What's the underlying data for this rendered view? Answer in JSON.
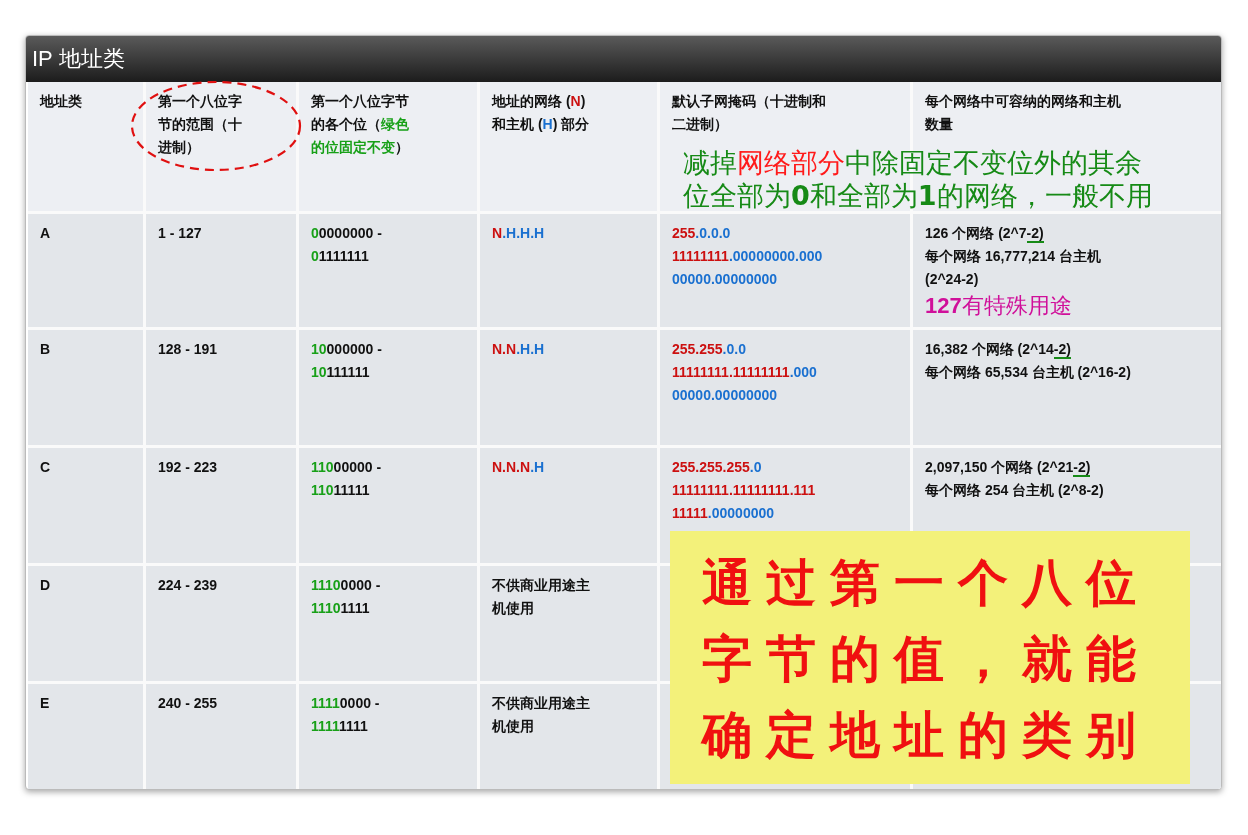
{
  "panel": {
    "title": "IP 地址类"
  },
  "table": {
    "columns": [
      {
        "lines": [
          [
            {
              "text": "地址类"
            }
          ]
        ]
      },
      {
        "lines": [
          [
            {
              "text": "第一个八位字"
            }
          ],
          [
            {
              "text": "节的范围（十"
            }
          ],
          [
            {
              "text": "进制）"
            }
          ]
        ]
      },
      {
        "lines": [
          [
            {
              "text": "第一个八位字节"
            }
          ],
          [
            {
              "text": "的各个位（"
            },
            {
              "text": "绿色",
              "color": "#18a018"
            }
          ],
          [
            {
              "text": "的位固定不变",
              "color": "#18a018"
            },
            {
              "text": "）"
            }
          ]
        ]
      },
      {
        "lines": [
          [
            {
              "text": "地址的网络 ("
            },
            {
              "text": "N",
              "color": "#cc1010"
            },
            {
              "text": ")"
            }
          ],
          [
            {
              "text": "和主机 ("
            },
            {
              "text": "H",
              "color": "#1a70d0"
            },
            {
              "text": ") 部分"
            }
          ]
        ]
      },
      {
        "lines": [
          [
            {
              "text": "默认子网掩码（十进制和"
            }
          ],
          [
            {
              "text": "二进制）"
            }
          ]
        ]
      },
      {
        "lines": [
          [
            {
              "text": "每个网络中可容纳的网络和主机"
            }
          ],
          [
            {
              "text": "数量"
            }
          ]
        ]
      }
    ],
    "rows": [
      {
        "cells": [
          {
            "lines": [
              [
                {
                  "text": "A"
                }
              ]
            ]
          },
          {
            "lines": [
              [
                {
                  "text": "1 - 127"
                }
              ]
            ]
          },
          {
            "lines": [
              [
                {
                  "text": "0",
                  "color": "#18a018"
                },
                {
                  "text": "0000000 -"
                }
              ],
              [
                {
                  "text": "0",
                  "color": "#18a018"
                },
                {
                  "text": "1111111"
                }
              ]
            ]
          },
          {
            "lines": [
              [
                {
                  "text": "N",
                  "color": "#cc1010"
                },
                {
                  "text": ".H.H.H",
                  "color": "#1a70d0"
                }
              ]
            ]
          },
          {
            "lines": [
              [
                {
                  "text": "255",
                  "color": "#cc1010"
                },
                {
                  "text": ".0.0.0",
                  "color": "#1a70d0"
                }
              ],
              [
                {
                  "text": "11111111",
                  "color": "#cc1010"
                },
                {
                  "text": ".00000000.000",
                  "color": "#1a70d0"
                }
              ],
              [
                {
                  "text": "00000.00000000",
                  "color": "#1a70d0"
                }
              ]
            ]
          },
          {
            "lines": [
              [
                {
                  "text": "126 个网络 (2^7"
                },
                {
                  "text": "-2)",
                  "underline": true
                }
              ],
              [
                {
                  "text": "每个网络 16,777,214 台主机"
                }
              ],
              [
                {
                  "text": "(2^24-2)"
                }
              ]
            ],
            "note": [
              {
                "text": "127",
                "bold": true
              },
              {
                "text": "有特殊用途"
              }
            ]
          }
        ]
      },
      {
        "cells": [
          {
            "lines": [
              [
                {
                  "text": "B"
                }
              ]
            ]
          },
          {
            "lines": [
              [
                {
                  "text": "128 - 191"
                }
              ]
            ]
          },
          {
            "lines": [
              [
                {
                  "text": "10",
                  "color": "#18a018"
                },
                {
                  "text": "000000 -"
                }
              ],
              [
                {
                  "text": "10",
                  "color": "#18a018"
                },
                {
                  "text": "111111"
                }
              ]
            ]
          },
          {
            "lines": [
              [
                {
                  "text": "N.N",
                  "color": "#cc1010"
                },
                {
                  "text": ".H.H",
                  "color": "#1a70d0"
                }
              ]
            ]
          },
          {
            "lines": [
              [
                {
                  "text": "255.255",
                  "color": "#cc1010"
                },
                {
                  "text": ".0.0",
                  "color": "#1a70d0"
                }
              ],
              [
                {
                  "text": "11111111.11111111",
                  "color": "#cc1010"
                },
                {
                  "text": ".000",
                  "color": "#1a70d0"
                }
              ],
              [
                {
                  "text": "00000.00000000",
                  "color": "#1a70d0"
                }
              ]
            ]
          },
          {
            "lines": [
              [
                {
                  "text": "16,382 个网络 (2^14"
                },
                {
                  "text": "-2)",
                  "underline": true
                }
              ],
              [
                {
                  "text": "每个网络 65,534 台主机 (2^16-2)"
                }
              ]
            ]
          }
        ]
      },
      {
        "cells": [
          {
            "lines": [
              [
                {
                  "text": "C"
                }
              ]
            ]
          },
          {
            "lines": [
              [
                {
                  "text": "192 - 223"
                }
              ]
            ]
          },
          {
            "lines": [
              [
                {
                  "text": "110",
                  "color": "#18a018"
                },
                {
                  "text": "00000 -"
                }
              ],
              [
                {
                  "text": "110",
                  "color": "#18a018"
                },
                {
                  "text": "11111"
                }
              ]
            ]
          },
          {
            "lines": [
              [
                {
                  "text": "N.N.N",
                  "color": "#cc1010"
                },
                {
                  "text": ".H",
                  "color": "#1a70d0"
                }
              ]
            ]
          },
          {
            "lines": [
              [
                {
                  "text": "255.255.255",
                  "color": "#cc1010"
                },
                {
                  "text": ".0",
                  "color": "#1a70d0"
                }
              ],
              [
                {
                  "text": "11111111.11111111.111",
                  "color": "#cc1010"
                }
              ],
              [
                {
                  "text": "11111",
                  "color": "#cc1010"
                },
                {
                  "text": ".00000000",
                  "color": "#1a70d0"
                }
              ]
            ]
          },
          {
            "lines": [
              [
                {
                  "text": "2,097,150 个网络 (2^21"
                },
                {
                  "text": "-2)",
                  "underline": true
                }
              ],
              [
                {
                  "text": "每个网络 254 台主机 (2^8-2)"
                }
              ]
            ]
          }
        ]
      },
      {
        "cells": [
          {
            "lines": [
              [
                {
                  "text": "D"
                }
              ]
            ]
          },
          {
            "lines": [
              [
                {
                  "text": "224 - 239"
                }
              ]
            ]
          },
          {
            "lines": [
              [
                {
                  "text": "1110",
                  "color": "#18a018"
                },
                {
                  "text": "0000 -"
                }
              ],
              [
                {
                  "text": "1110",
                  "color": "#18a018"
                },
                {
                  "text": "1111"
                }
              ]
            ]
          },
          {
            "lines": [
              [
                {
                  "text": "不供商业用途主"
                }
              ],
              [
                {
                  "text": "机使用"
                }
              ]
            ]
          },
          {},
          {}
        ]
      },
      {
        "cells": [
          {
            "lines": [
              [
                {
                  "text": "E"
                }
              ]
            ]
          },
          {
            "lines": [
              [
                {
                  "text": "240 - 255"
                }
              ]
            ]
          },
          {
            "lines": [
              [
                {
                  "text": "1111",
                  "color": "#18a018"
                },
                {
                  "text": "0000 -"
                }
              ],
              [
                {
                  "text": "1111",
                  "color": "#18a018"
                },
                {
                  "text": "1111"
                }
              ]
            ]
          },
          {
            "lines": [
              [
                {
                  "text": "不供商业用途主"
                }
              ],
              [
                {
                  "text": "机使用"
                }
              ]
            ]
          },
          {},
          {}
        ]
      }
    ]
  },
  "header_note": {
    "lines": [
      [
        {
          "text": "减掉",
          "color": "#168a16"
        },
        {
          "text": "网络部分",
          "color": "#ff1a1a"
        },
        {
          "text": "中除固定不变位外的其余",
          "color": "#168a16"
        }
      ],
      [
        {
          "text": "位全部为",
          "color": "#168a16"
        },
        {
          "text": "0",
          "color": "#168a16",
          "bold": true
        },
        {
          "text": "和全部为",
          "color": "#168a16"
        },
        {
          "text": "1",
          "color": "#168a16",
          "bold": true
        },
        {
          "text": "的网络，一般不用",
          "color": "#168a16"
        }
      ]
    ]
  },
  "callout": {
    "lines": [
      "通过第一个八位",
      "字节的值，就能",
      "确定地址的类别"
    ]
  }
}
